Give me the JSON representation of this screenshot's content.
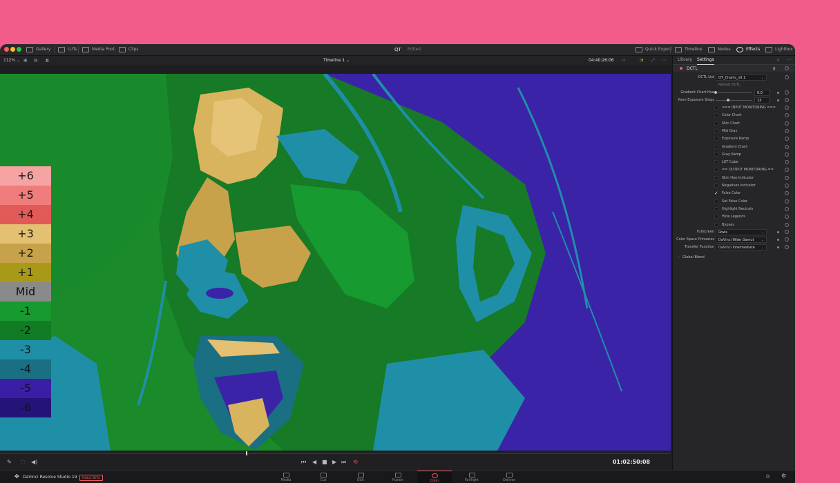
{
  "window": {
    "title": "QT",
    "subtitle": "Edited"
  },
  "topbar": {
    "left": [
      "Gallery",
      "LUTs",
      "Media Pool",
      "Clips"
    ],
    "right": [
      "Quick Export",
      "Timeline",
      "Nodes",
      "Effects",
      "Lightbox"
    ]
  },
  "viewer_bar": {
    "zoom": "112%",
    "timeline": "Timeline 1",
    "timecode": "04:40:26:06"
  },
  "false_color_scale": [
    {
      "label": "+6",
      "color": "#f5a3a3",
      "text": "#1a1a1a"
    },
    {
      "label": "+5",
      "color": "#ef7d7b",
      "text": "#1a1a1a"
    },
    {
      "label": "+4",
      "color": "#e25a57",
      "text": "#1a1a1a"
    },
    {
      "label": "+3",
      "color": "#e3c072",
      "text": "#1a1a1a"
    },
    {
      "label": "+2",
      "color": "#c8a24a",
      "text": "#1a1a1a"
    },
    {
      "label": "+1",
      "color": "#a89a18",
      "text": "#1a1a1a"
    },
    {
      "label": "Mid",
      "color": "#8a8a8a",
      "text": "#111111"
    },
    {
      "label": "-1",
      "color": "#179a2f",
      "text": "#111111"
    },
    {
      "label": "-2",
      "color": "#127c24",
      "text": "#111111"
    },
    {
      "label": "-3",
      "color": "#1f8fa8",
      "text": "#111111"
    },
    {
      "label": "-4",
      "color": "#1a6f82",
      "text": "#111111"
    },
    {
      "label": "-5",
      "color": "#3a1fa6",
      "text": "#111111"
    },
    {
      "label": "-6",
      "color": "#241478",
      "text": "#111111"
    }
  ],
  "transport": {
    "timecode": "01:02:50:08"
  },
  "panel": {
    "tabs": [
      "Library",
      "Settings"
    ],
    "active_tab": "Settings",
    "effect_name": "DCTL",
    "dctl_list_label": "DCTL List",
    "dctl_list_value": "QT_Charts_v0.1",
    "reload_label": "Reload DCTL",
    "gradient_hue_label": "Gradient Chart Hue",
    "gradient_hue_value": "0.0",
    "gradient_hue_fraction": 0.0,
    "exposure_steps_label": "Num Exposure Steps",
    "exposure_steps_value": "13",
    "exposure_steps_fraction": 0.35,
    "checkboxes": [
      {
        "label": "=== INPUT MONITORING ===",
        "checked": false
      },
      {
        "label": "Color Chart",
        "checked": false
      },
      {
        "label": "Skin Chart",
        "checked": false
      },
      {
        "label": "Mid Gray",
        "checked": false
      },
      {
        "label": "Exposure Ramp",
        "checked": false
      },
      {
        "label": "Gradient Chart",
        "checked": false
      },
      {
        "label": "Gray Ramp",
        "checked": false
      },
      {
        "label": "LUT Cube",
        "checked": false
      },
      {
        "label": "== OUTPUT MONITORING ==",
        "checked": false
      },
      {
        "label": "Skin Hue Indicator",
        "checked": false
      },
      {
        "label": "Negatives Indicator",
        "checked": false
      },
      {
        "label": "False Color",
        "checked": true
      },
      {
        "label": "Sat False Color",
        "checked": false
      },
      {
        "label": "Highlight Neutrals",
        "checked": false
      },
      {
        "label": "Hide Legends",
        "checked": false
      },
      {
        "label": "Bypass",
        "checked": false
      }
    ],
    "selects": [
      {
        "label": "Fullscreen",
        "value": "Rows"
      },
      {
        "label": "Color Space Primaries",
        "value": "DaVinci Wide Gamut"
      },
      {
        "label": "Transfer Function",
        "value": "DaVinci Intermediate"
      }
    ],
    "global_blend": "Global Blend"
  },
  "bottombar": {
    "app_name": "DaVinci Resolve Studio 19",
    "badge": "PUBLIC BETA",
    "pages": [
      "Media",
      "Cut",
      "Edit",
      "Fusion",
      "Color",
      "Fairlight",
      "Deliver"
    ],
    "active_page": "Color"
  },
  "colors": {
    "accent": "#f15a60",
    "background": "#f15c8b"
  }
}
